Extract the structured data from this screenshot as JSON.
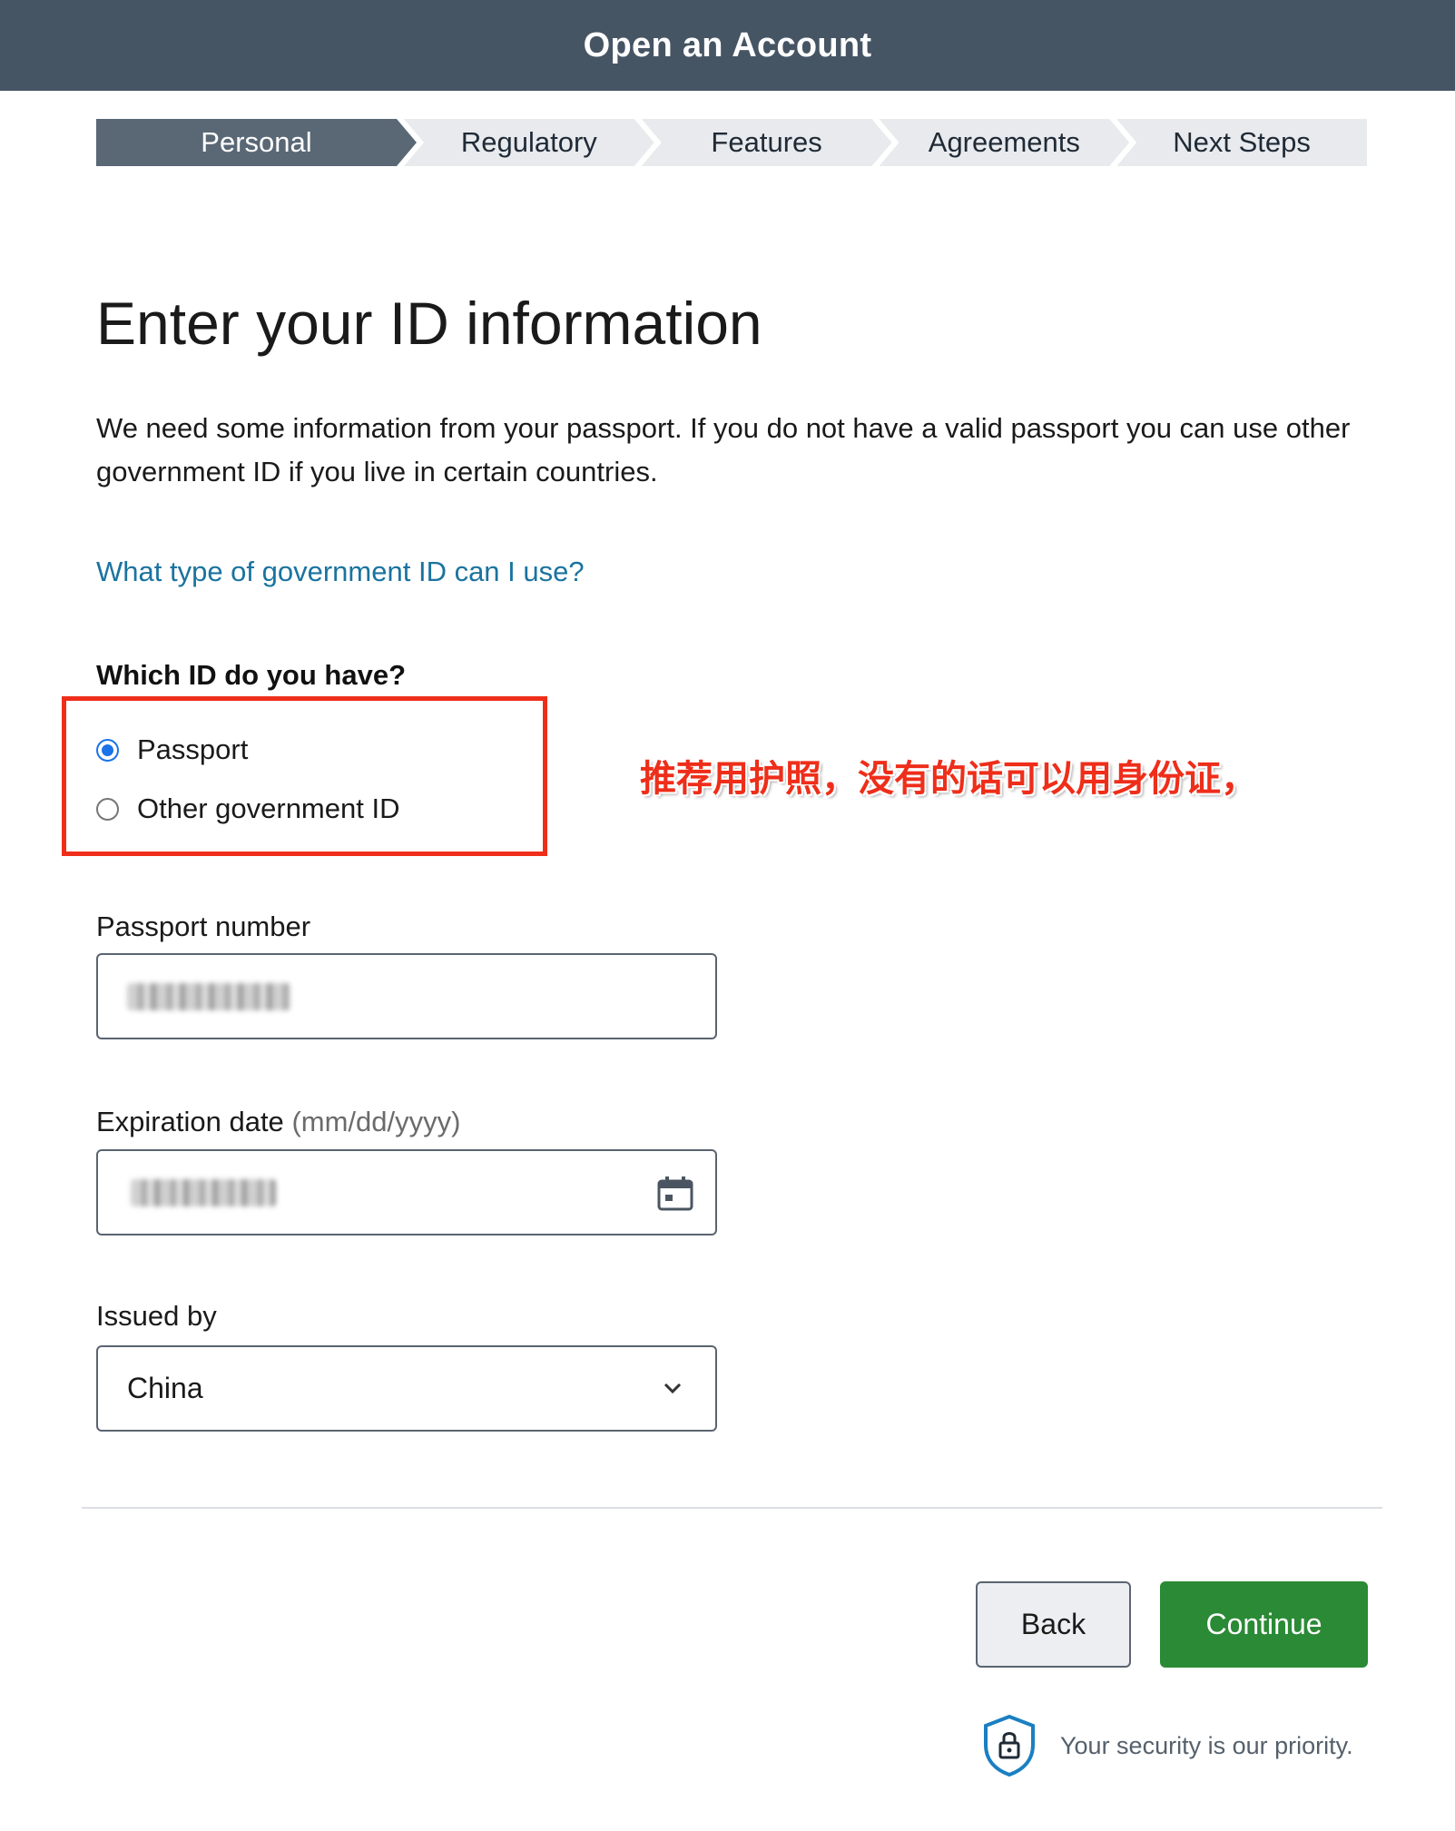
{
  "header": {
    "title": "Open an Account"
  },
  "steps": [
    {
      "label": "Personal",
      "active": true
    },
    {
      "label": "Regulatory",
      "active": false
    },
    {
      "label": "Features",
      "active": false
    },
    {
      "label": "Agreements",
      "active": false
    },
    {
      "label": "Next Steps",
      "active": false
    }
  ],
  "main": {
    "title": "Enter your ID information",
    "intro": "We need some information from your passport. If you do not have a valid passport you can use other government ID if you live in certain countries.",
    "help_link": "What type of government ID can I use?"
  },
  "id_type": {
    "question": "Which ID do you have?",
    "options": [
      {
        "label": "Passport",
        "checked": true
      },
      {
        "label": "Other government ID",
        "checked": false
      }
    ]
  },
  "annotation": "推荐用护照，没有的话可以用身份证，",
  "passport_number": {
    "label": "Passport number"
  },
  "expiration_date": {
    "label": "Expiration date",
    "hint": "(mm/dd/yyyy)",
    "icon": "calendar-icon"
  },
  "issued_by": {
    "label": "Issued by",
    "value": "China",
    "icon": "chevron-down-icon"
  },
  "buttons": {
    "back": "Back",
    "continue": "Continue"
  },
  "footer": {
    "security_text": "Your security is our priority.",
    "icon": "shield-lock-icon"
  },
  "colors": {
    "header": "#465564",
    "active_step": "#5a6775",
    "link": "#1a73a0",
    "continue": "#2b8a35",
    "annotation": "#ee2e1a"
  }
}
